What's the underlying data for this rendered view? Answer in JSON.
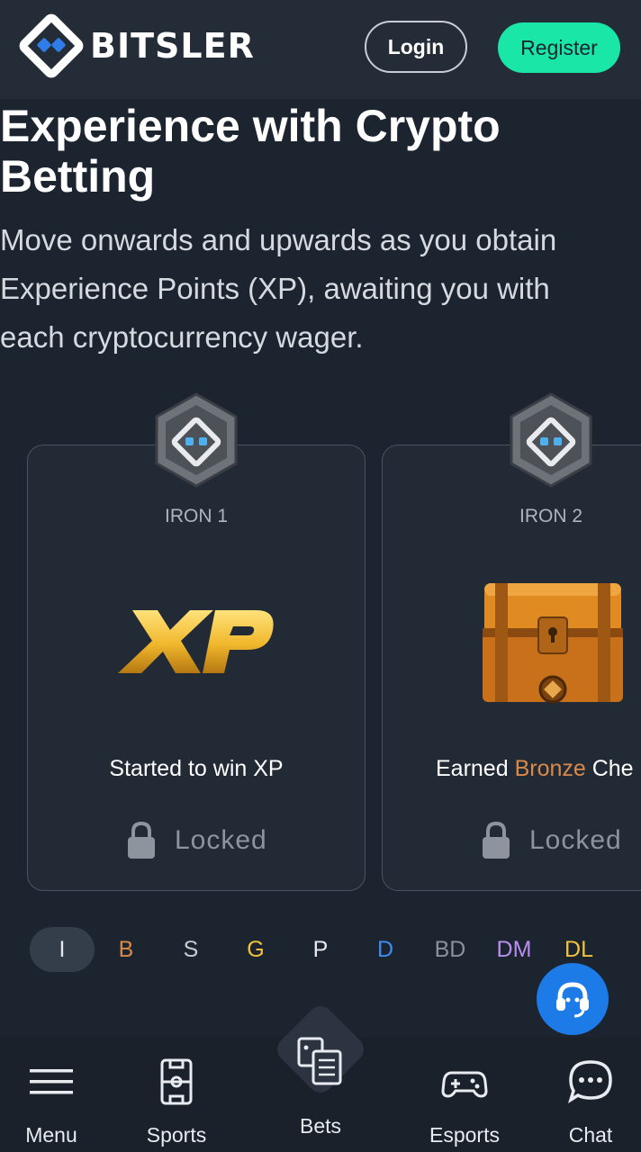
{
  "header": {
    "brand": "BITSLER",
    "login_label": "Login",
    "register_label": "Register"
  },
  "hero": {
    "title": "Experience with Crypto Betting",
    "description": "Move onwards and upwards as you obtain Experience Points (XP), awaiting you with each cryptocurrency wager."
  },
  "cards": [
    {
      "rank": "IRON 1",
      "reward": "Started to win XP",
      "status": "Locked",
      "art": "xp-logo"
    },
    {
      "rank": "IRON 2",
      "reward_prefix": "Earned ",
      "reward_highlight": "Bronze",
      "reward_suffix": " Che",
      "status": "Locked",
      "art": "treasure-chest"
    }
  ],
  "tiers": [
    {
      "label": "I",
      "color": "#e6e8eb",
      "active": true
    },
    {
      "label": "B",
      "color": "#d98a4a"
    },
    {
      "label": "S",
      "color": "#c8ccd2"
    },
    {
      "label": "G",
      "color": "#f2c23c"
    },
    {
      "label": "P",
      "color": "#e6e8eb"
    },
    {
      "label": "D",
      "color": "#3f8cf0"
    },
    {
      "label": "BD",
      "color": "#8a919b"
    },
    {
      "label": "DM",
      "color": "#b88ef0"
    },
    {
      "label": "DL",
      "color": "#f2c23c"
    }
  ],
  "bottom_nav": {
    "menu": "Menu",
    "sports": "Sports",
    "bets": "Bets",
    "esports": "Esports",
    "chat": "Chat"
  },
  "colors": {
    "background": "#1c242f",
    "header": "#242c38",
    "accent": "#19e6a7",
    "support": "#1c7be6"
  }
}
